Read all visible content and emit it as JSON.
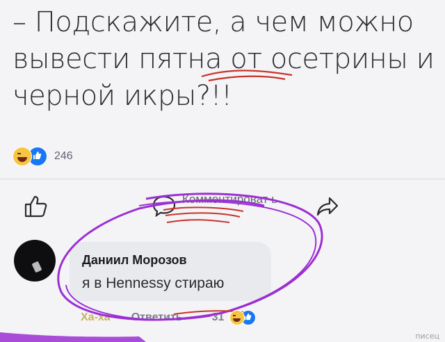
{
  "post": {
    "lines": [
      "– Подскажите, а чем можно",
      "вывести пятна от осетрины и",
      "черной икры?!!"
    ]
  },
  "reactions": {
    "count": "246",
    "icons": [
      "haha-icon",
      "like-icon"
    ]
  },
  "actions": {
    "comment_label": "Комментироват ь"
  },
  "comment": {
    "author": "Даниил Морозов",
    "text": "я в Hennessy стираю",
    "haha_link": "Ха-ха",
    "reply_link": "Ответить",
    "reaction_count": "31"
  },
  "watermark": "писец",
  "colors": {
    "like_blue": "#1877f2",
    "haha_yellow": "#f7c540",
    "scribble_purple": "#9b2fd3",
    "underline_red": "#c8322a"
  }
}
